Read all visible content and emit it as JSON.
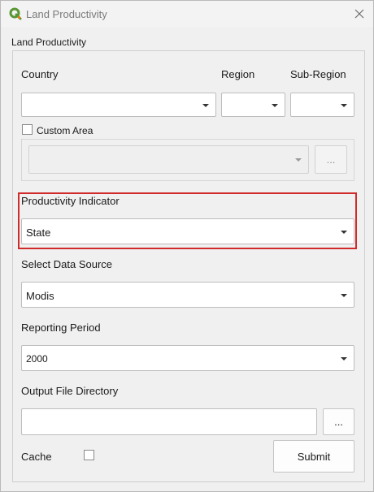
{
  "window": {
    "title": "Land Productivity",
    "close_symbol": "✕"
  },
  "group": {
    "title": "Land Productivity"
  },
  "country": {
    "label": "Country",
    "value": ""
  },
  "region": {
    "label": "Region",
    "value": ""
  },
  "subregion": {
    "label": "Sub-Region",
    "value": ""
  },
  "custom_area": {
    "label": "Custom Area",
    "checked": false,
    "value": "",
    "browse_label": "..."
  },
  "productivity_indicator": {
    "label": "Productivity Indicator",
    "value": "State"
  },
  "data_source": {
    "label": "Select Data Source",
    "value": "Modis"
  },
  "reporting_period": {
    "label": "Reporting Period",
    "value": "2000"
  },
  "output_dir": {
    "label": "Output File Directory",
    "value": "",
    "browse_label": "..."
  },
  "cache": {
    "label": "Cache",
    "checked": false
  },
  "submit": {
    "label": "Submit"
  },
  "colors": {
    "highlight": "#d02a2a",
    "qgis_green": "#589632",
    "qgis_yellow": "#ee7913"
  },
  "icons": {
    "app": "qgis-logo-icon",
    "close": "close-icon",
    "dropdown": "chevron-down-icon"
  }
}
